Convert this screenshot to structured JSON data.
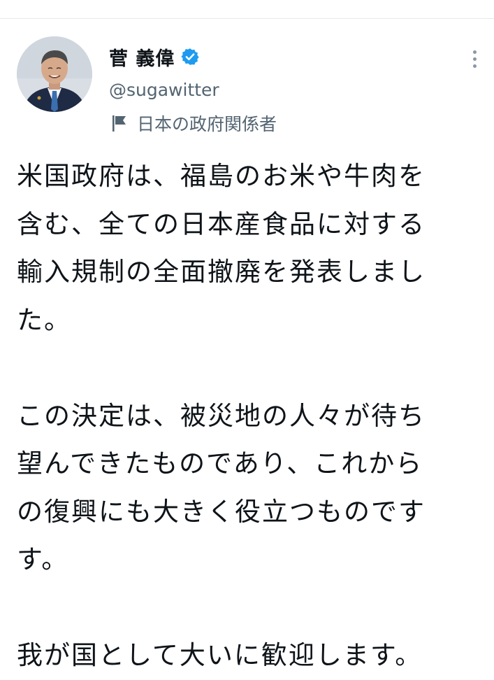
{
  "author": {
    "display_name": "菅 義偉",
    "handle": "@sugawitter",
    "account_label": "日本の政府関係者",
    "verified": true,
    "verified_color": "#1d9bf0"
  },
  "icons": {
    "avatar": "profile-photo",
    "verified": "verified-badge-icon",
    "label": "flag-icon",
    "more": "more-vertical-icon"
  },
  "tweet": {
    "lines": [
      "米国政府は、福島のお米や牛肉を",
      "含む、全ての日本産食品に対する",
      "輸入規制の全面撤廃を発表しまし",
      "た。",
      "",
      "この決定は、被災地の人々が待ち",
      "望んできたものであり、これから",
      "の復興にも大きく役立つものです",
      "す。",
      "",
      "我が国として大いに歓迎します。"
    ]
  }
}
